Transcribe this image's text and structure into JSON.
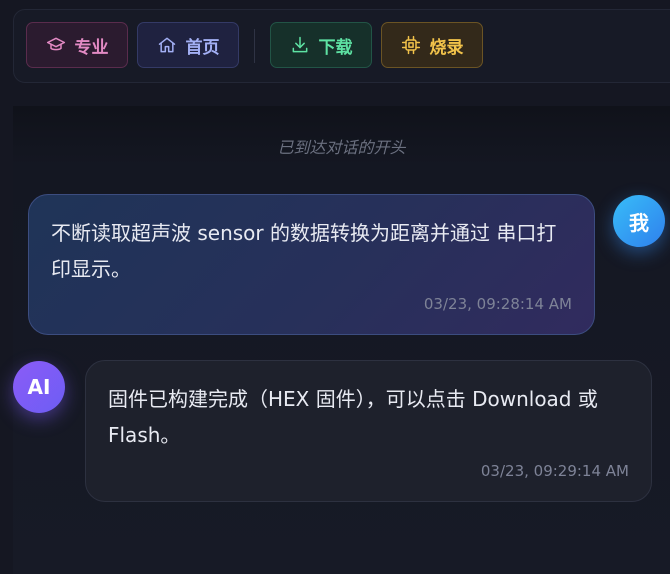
{
  "toolbar": {
    "buttons": [
      {
        "label": "专业",
        "icon": "graduation-cap-icon",
        "color": "#e38ac4"
      },
      {
        "label": "首页",
        "icon": "home-icon",
        "color": "#a3b0f5"
      },
      {
        "label": "下载",
        "icon": "download-icon",
        "color": "#5ee2a3"
      },
      {
        "label": "烧录",
        "icon": "chip-icon",
        "color": "#f1c24a"
      }
    ]
  },
  "chat": {
    "start_notice": "已到达对话的开头",
    "messages": [
      {
        "role": "user",
        "avatar": "我",
        "text": "不断读取超声波 sensor 的数据转换为距离并通过 串口打印显示。",
        "timestamp": "03/23, 09:28:14 AM"
      },
      {
        "role": "ai",
        "avatar": "AI",
        "text": "固件已构建完成（HEX 固件），可以点击 Download 或 Flash。",
        "timestamp": "03/23, 09:29:14 AM"
      }
    ]
  }
}
